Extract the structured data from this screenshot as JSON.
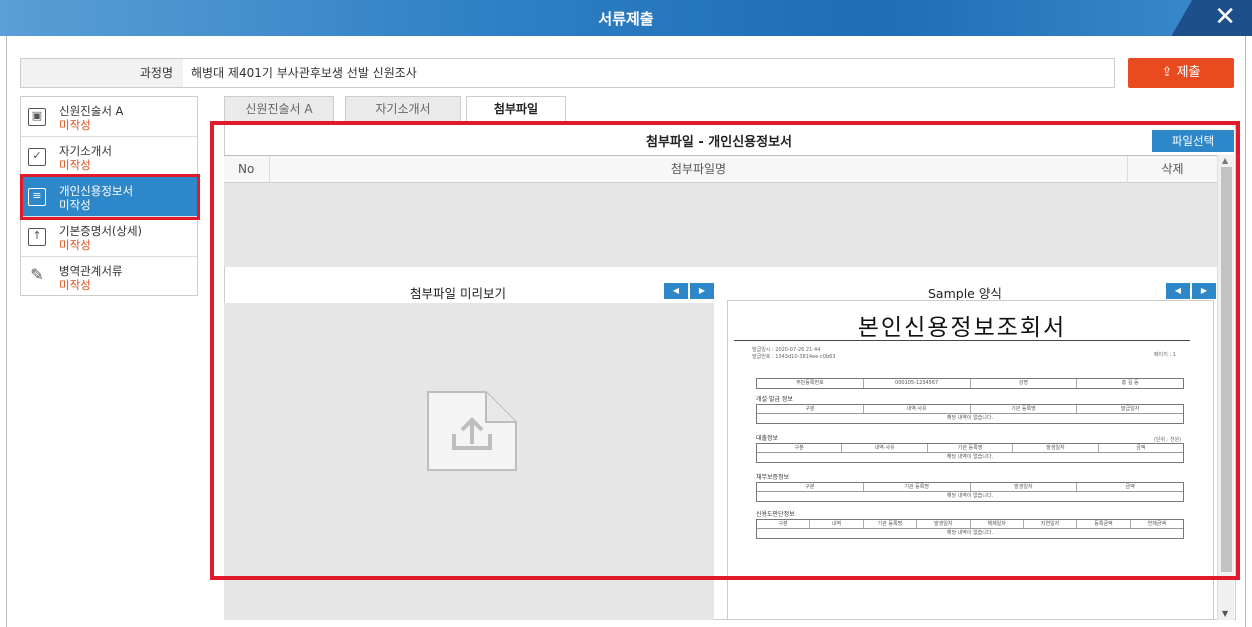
{
  "window": {
    "title": "서류제출",
    "close_icon": "close-icon"
  },
  "course": {
    "label": "과정명",
    "value": "해병대 제401기 부사관후보생 선발 신원조사"
  },
  "submit": {
    "label": "제출",
    "icon": "upload-icon"
  },
  "sidebar": {
    "items": [
      {
        "name": "신원진술서 A",
        "status": "미작성",
        "icon": "document-stamp-icon"
      },
      {
        "name": "자기소개서",
        "status": "미작성",
        "icon": "checkbox-icon"
      },
      {
        "name": "개인신용정보서",
        "status": "미작성",
        "icon": "document-list-icon"
      },
      {
        "name": "기본증명서(상세)",
        "status": "미작성",
        "icon": "upload-box-icon"
      },
      {
        "name": "병역관계서류",
        "status": "미작성",
        "icon": "edit-icon"
      }
    ]
  },
  "tabs": [
    {
      "label": "신원진술서 A"
    },
    {
      "label": "자기소개서"
    },
    {
      "label": "첨부파일"
    }
  ],
  "attachment": {
    "title": "첨부파일 - 개인신용정보서",
    "file_select_label": "파일선택",
    "columns": {
      "no": "No",
      "name": "첨부파일명",
      "delete": "삭제"
    }
  },
  "preview": {
    "title": "첨부파일 미리보기",
    "prev_icon": "arrow-left-icon",
    "next_icon": "arrow-right-icon"
  },
  "sample": {
    "title": "Sample 양식",
    "document": {
      "heading": "본인신용정보조회서",
      "meta_line1": "발급일시 : 2020-07-26 21:44",
      "meta_line2": "발급번호 : 1343d10-3814ee-c0b63",
      "page_label": "페이지 : 1",
      "id_row": [
        "주민등록번호",
        "000105-1234567",
        "성명",
        "홍 길 동"
      ],
      "sections": [
        {
          "name": "개설·발급 정보",
          "cols": [
            "구분",
            "내역·사유",
            "기관 등록명",
            "발급일자"
          ],
          "empty": "해당 내역이 없습니다."
        },
        {
          "name": "대출정보",
          "cols": [
            "구분",
            "내역·사유",
            "기관 등록명",
            "발생일자",
            "금액"
          ],
          "empty": "해당 내역이 없습니다."
        },
        {
          "name": "채무보증정보",
          "cols": [
            "구분",
            "기관 등록명",
            "발생일자",
            "금액"
          ],
          "empty": "해당 내역이 없습니다."
        },
        {
          "name": "신용도판단정보",
          "cols": [
            "구분",
            "내역",
            "기관 등록명",
            "발생일자",
            "해제일자",
            "지연일자",
            "등록금액",
            "연체금액"
          ],
          "empty": "해당 내역이 없습니다."
        }
      ],
      "unit_label": "(단위 : 천원)"
    }
  }
}
